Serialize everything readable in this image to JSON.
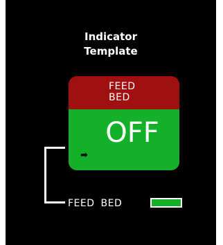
{
  "title": {
    "line1": "Indicator",
    "line2": "Template"
  },
  "indicator": {
    "header_line1": "FEED",
    "header_line2": "BED",
    "state": "OFF",
    "header_color": "#a01010",
    "body_color": "#15b029",
    "arrow_icon": "right-arrow-icon",
    "arrow_glyph": "➡"
  },
  "legend": {
    "word1": "FEED",
    "word2": "BED",
    "swatch_color": "#15b029"
  }
}
